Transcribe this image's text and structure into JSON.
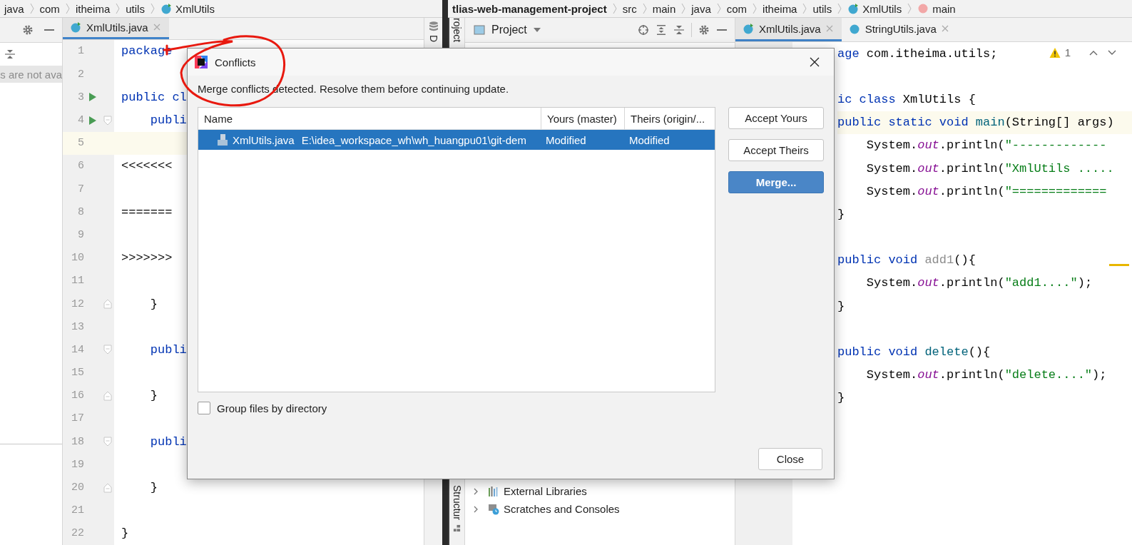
{
  "left_window": {
    "breadcrumbs": [
      {
        "label": "java",
        "kind": "folder"
      },
      {
        "label": "com",
        "kind": "folder"
      },
      {
        "label": "itheima",
        "kind": "folder"
      },
      {
        "label": "utils",
        "kind": "folder"
      },
      {
        "label": "XmlUtils",
        "kind": "class"
      }
    ],
    "side_panel": {
      "message": "s are not ava"
    },
    "tabs": [
      {
        "label": "XmlUtils.java",
        "selected": true
      }
    ],
    "side_strip": {
      "label": "D"
    },
    "editor": {
      "lines": [
        {
          "number": "1",
          "run": false,
          "current": false,
          "tokens": [
            {
              "text": "package",
              "kind": "keyword"
            }
          ]
        },
        {
          "number": "2",
          "run": false,
          "current": false
        },
        {
          "number": "3",
          "run": true,
          "current": false,
          "tokens": [
            {
              "text": "public cl",
              "kind": "keyword"
            }
          ]
        },
        {
          "number": "4",
          "run": true,
          "current": false,
          "kind": "fold_start",
          "tokens": [
            {
              "text": "    publi",
              "kind": "keyword"
            }
          ]
        },
        {
          "number": "5",
          "run": false,
          "current": true
        },
        {
          "number": "6",
          "run": false,
          "current": false,
          "tokens": [
            {
              "text": "<<<<<<<",
              "kind": "plain"
            }
          ]
        },
        {
          "number": "7",
          "run": false,
          "current": false
        },
        {
          "number": "8",
          "run": false,
          "current": false,
          "tokens": [
            {
              "text": "=======",
              "kind": "plain"
            }
          ]
        },
        {
          "number": "9",
          "run": false,
          "current": false
        },
        {
          "number": "10",
          "run": false,
          "current": false,
          "tokens": [
            {
              "text": ">>>>>>>",
              "kind": "plain"
            }
          ]
        },
        {
          "number": "11",
          "run": false,
          "current": false
        },
        {
          "number": "12",
          "run": false,
          "current": false,
          "kind": "fold_end",
          "tokens": [
            {
              "text": "    }",
              "kind": "plain"
            }
          ]
        },
        {
          "number": "13",
          "run": false,
          "current": false
        },
        {
          "number": "14",
          "run": false,
          "current": false,
          "kind": "fold_start",
          "tokens": [
            {
              "text": "    publi",
              "kind": "keyword"
            }
          ]
        },
        {
          "number": "15",
          "run": false,
          "current": false
        },
        {
          "number": "16",
          "run": false,
          "current": false,
          "kind": "fold_end",
          "tokens": [
            {
              "text": "    }",
              "kind": "plain"
            }
          ]
        },
        {
          "number": "17",
          "run": false,
          "current": false
        },
        {
          "number": "18",
          "run": false,
          "current": false,
          "kind": "fold_start",
          "tokens": [
            {
              "text": "    publi",
              "kind": "keyword"
            }
          ]
        },
        {
          "number": "19",
          "run": false,
          "current": false
        },
        {
          "number": "20",
          "run": false,
          "current": false,
          "kind": "fold_end",
          "tokens": [
            {
              "text": "    }",
              "kind": "plain"
            }
          ]
        },
        {
          "number": "21",
          "run": false,
          "current": false
        },
        {
          "number": "22",
          "run": false,
          "current": false,
          "tokens": [
            {
              "text": "}",
              "kind": "plain"
            }
          ]
        }
      ]
    }
  },
  "right_window": {
    "breadcrumbs": [
      {
        "label": "tlias-web-management-project",
        "kind": "project"
      },
      {
        "label": "src",
        "kind": "folder"
      },
      {
        "label": "main",
        "kind": "folder"
      },
      {
        "label": "java",
        "kind": "folder"
      },
      {
        "label": "com",
        "kind": "folder"
      },
      {
        "label": "itheima",
        "kind": "folder"
      },
      {
        "label": "utils",
        "kind": "folder"
      },
      {
        "label": "XmlUtils",
        "kind": "class"
      },
      {
        "label": "main",
        "kind": "method"
      }
    ],
    "tool_stripe": {
      "top": "roject",
      "bottom": "Structur"
    },
    "project_panel": {
      "title": "Project",
      "tree": [
        {
          "label": "External Libraries",
          "kind": "libraries",
          "expanded": false
        },
        {
          "label": "Scratches and Consoles",
          "kind": "scratches",
          "expanded": false
        }
      ]
    },
    "tabs": [
      {
        "label": "XmlUtils.java",
        "selected": true
      },
      {
        "label": "StringUtils.java",
        "selected": false
      }
    ],
    "editor": {
      "warning_count": "1",
      "lines": [
        {
          "current": false,
          "tokens": [
            {
              "text": "age",
              "kind": "keyword"
            },
            {
              "text": " com.itheima.utils;",
              "kind": "plain"
            }
          ]
        },
        {
          "current": false
        },
        {
          "current": false,
          "tokens": [
            {
              "text": "ic class",
              "kind": "keyword"
            },
            {
              "text": " XmlUtils {",
              "kind": "plain"
            }
          ]
        },
        {
          "current": true,
          "tokens": [
            {
              "text": "public static void ",
              "kind": "keyword"
            },
            {
              "text": "main",
              "kind": "decl"
            },
            {
              "text": "(String[] args)",
              "kind": "plain"
            }
          ]
        },
        {
          "current": false,
          "tokens": [
            {
              "text": "    System.",
              "kind": "plain"
            },
            {
              "text": "out",
              "kind": "field"
            },
            {
              "text": ".println(",
              "kind": "plain"
            },
            {
              "text": "\"-------------",
              "kind": "string"
            }
          ]
        },
        {
          "current": false,
          "tokens": [
            {
              "text": "    System.",
              "kind": "plain"
            },
            {
              "text": "out",
              "kind": "field"
            },
            {
              "text": ".println(",
              "kind": "plain"
            },
            {
              "text": "\"XmlUtils .....",
              "kind": "string"
            }
          ]
        },
        {
          "current": false,
          "tokens": [
            {
              "text": "    System.",
              "kind": "plain"
            },
            {
              "text": "out",
              "kind": "field"
            },
            {
              "text": ".println(",
              "kind": "plain"
            },
            {
              "text": "\"=============",
              "kind": "string"
            }
          ]
        },
        {
          "current": false,
          "tokens": [
            {
              "text": "}",
              "kind": "plain"
            }
          ]
        },
        {
          "current": false
        },
        {
          "current": false,
          "tokens": [
            {
              "text": "public void ",
              "kind": "keyword"
            },
            {
              "text": "add1",
              "kind": "unused"
            },
            {
              "text": "(){",
              "kind": "plain"
            }
          ]
        },
        {
          "current": false,
          "tokens": [
            {
              "text": "    System.",
              "kind": "plain"
            },
            {
              "text": "out",
              "kind": "field"
            },
            {
              "text": ".println(",
              "kind": "plain"
            },
            {
              "text": "\"add1....\"",
              "kind": "string"
            },
            {
              "text": ");",
              "kind": "plain"
            }
          ]
        },
        {
          "current": false,
          "tokens": [
            {
              "text": "}",
              "kind": "plain"
            }
          ]
        },
        {
          "current": false
        },
        {
          "current": false,
          "tokens": [
            {
              "text": "public void ",
              "kind": "keyword"
            },
            {
              "text": "delete",
              "kind": "decl"
            },
            {
              "text": "(){",
              "kind": "plain"
            }
          ]
        },
        {
          "current": false,
          "tokens": [
            {
              "text": "    System.",
              "kind": "plain"
            },
            {
              "text": "out",
              "kind": "field"
            },
            {
              "text": ".println(",
              "kind": "plain"
            },
            {
              "text": "\"delete....\"",
              "kind": "string"
            },
            {
              "text": ");",
              "kind": "plain"
            }
          ]
        },
        {
          "current": false,
          "tokens": [
            {
              "text": "}",
              "kind": "plain"
            }
          ]
        }
      ]
    }
  },
  "dialog": {
    "title": "Conflicts",
    "message": "Merge conflicts detected. Resolve them before continuing update.",
    "columns": [
      "Name",
      "Yours (master)",
      "Theirs (origin/..."
    ],
    "rows": [
      {
        "file": "XmlUtils.java",
        "path": "E:\\idea_workspace_wh\\wh_huangpu01\\git-dem",
        "yours": "Modified",
        "theirs": "Modified",
        "selected": true
      }
    ],
    "actions": [
      {
        "label": "Accept Yours",
        "primary": false
      },
      {
        "label": "Accept Theirs",
        "primary": false
      },
      {
        "label": "Merge...",
        "primary": true
      }
    ],
    "group_by_directory": {
      "label": "Group files by directory",
      "checked": false
    },
    "close_button": "Close"
  }
}
